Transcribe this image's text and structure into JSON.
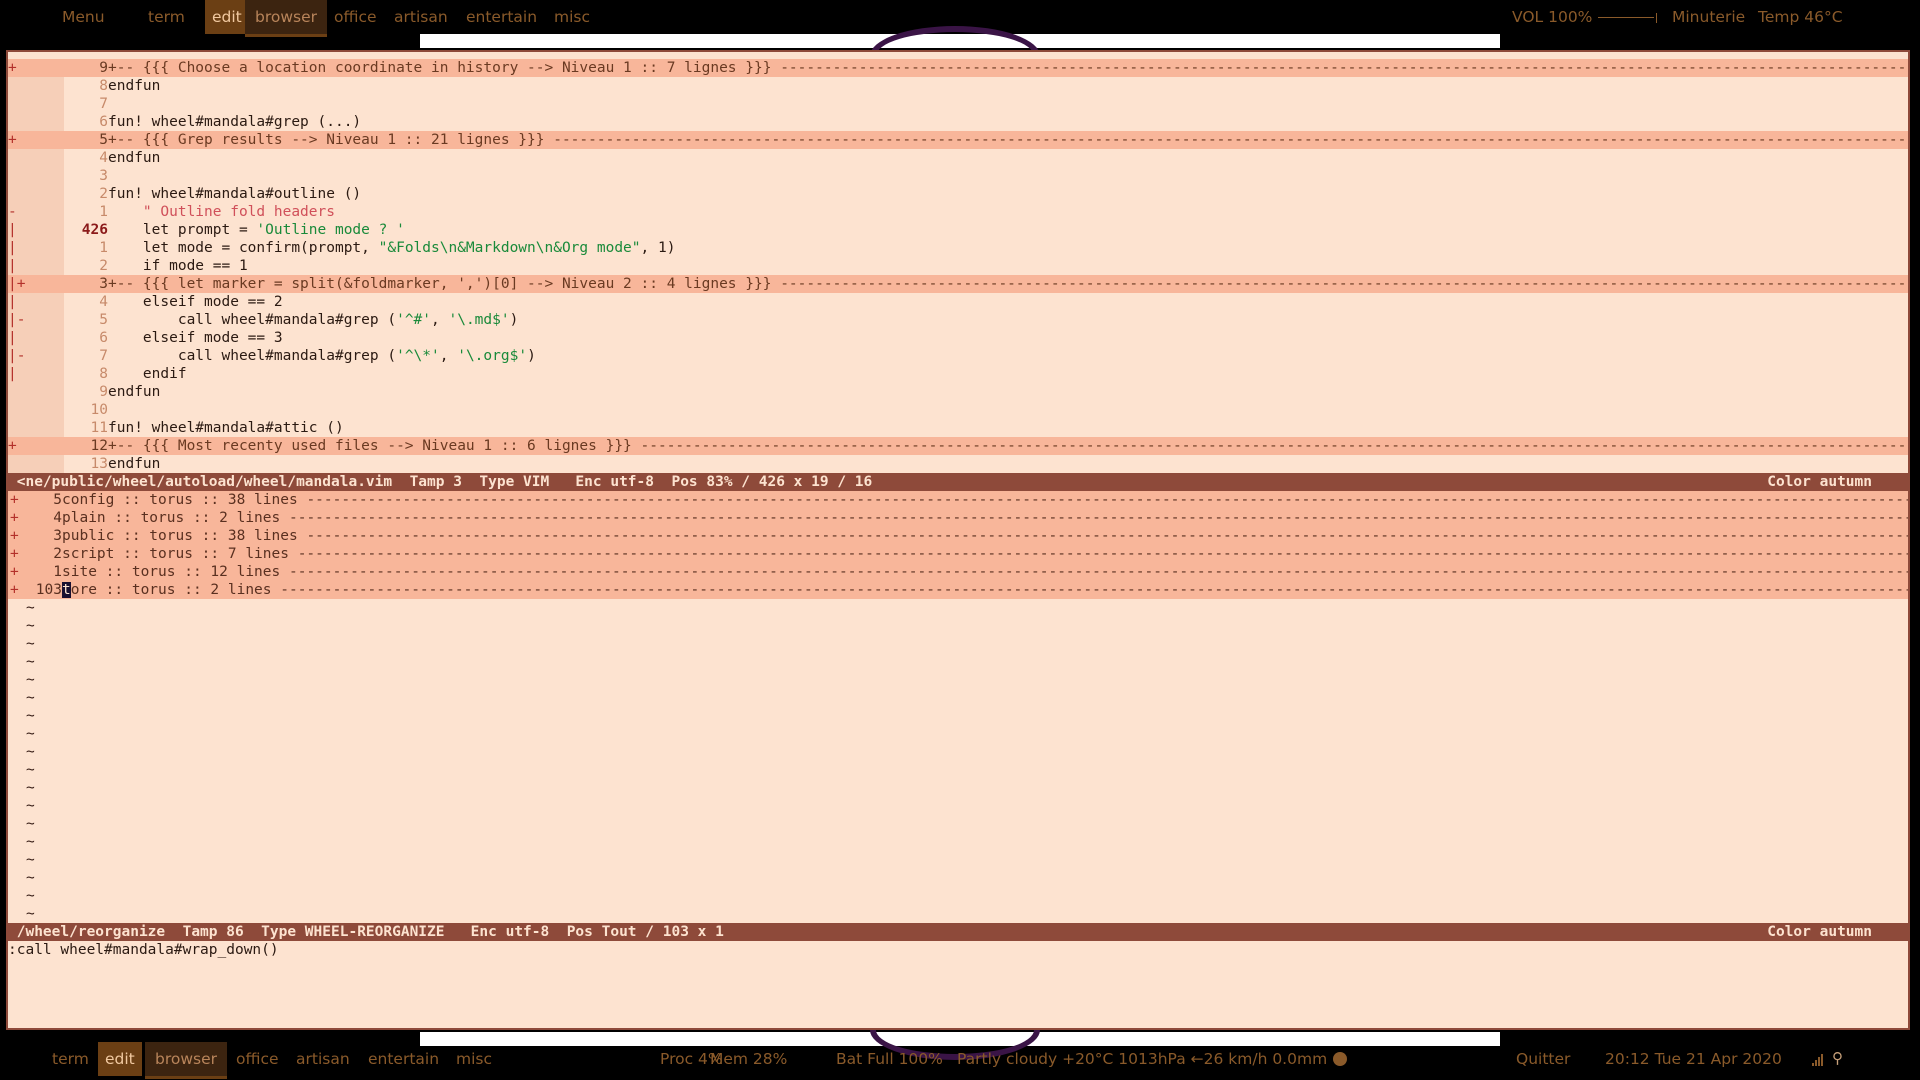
{
  "top_bar": {
    "menu": "Menu",
    "tags": [
      "term",
      "edit",
      "browser",
      "office",
      "artisan",
      "entertain",
      "misc"
    ],
    "volume": "VOL 100%",
    "timer": "Minuterie",
    "temp": "Temp  46°C"
  },
  "bottom_bar": {
    "tags": [
      "term",
      "edit",
      "browser",
      "office",
      "artisan",
      "entertain",
      "misc"
    ],
    "proc": "Proc  4%",
    "mem": "Mem 28%",
    "bat": "Bat Full 100%",
    "weather": "Partly cloudy +20°C 1013hPa ←26 km/h 0.0mm",
    "quit": "Quitter",
    "clock": "20:12  Tue 21 Apr 2020"
  },
  "editor_top": {
    "lines": [
      {
        "sign": "+",
        "num": "9",
        "text": "+-- {{{ Choose a location coordinate in history --> Niveau 1 :: 7 lignes }}} ",
        "fold": true
      },
      {
        "sign": "",
        "num": "8",
        "text": "endfun"
      },
      {
        "sign": "",
        "num": "7",
        "text": ""
      },
      {
        "sign": "",
        "num": "6",
        "text": "fun! wheel#mandala#grep (...)"
      },
      {
        "sign": "+",
        "num": "5",
        "text": "+-- {{{ Grep results --> Niveau 1 :: 21 lignes }}} ",
        "fold": true
      },
      {
        "sign": "",
        "num": "4",
        "text": "endfun"
      },
      {
        "sign": "",
        "num": "3",
        "text": ""
      },
      {
        "sign": "",
        "num": "2",
        "text": "fun! wheel#mandala#outline ()"
      },
      {
        "sign": "-",
        "num": "1",
        "text": "    \" Outline fold headers",
        "comment": true
      },
      {
        "sign": "|",
        "num": "426",
        "text": "    let prompt = 'Outline mode ? '",
        "cur": true
      },
      {
        "sign": "|",
        "num": "1",
        "text": "    let mode = confirm(prompt, \"&Folds\\n&Markdown\\n&Org mode\", 1)"
      },
      {
        "sign": "|",
        "num": "2",
        "text": "    if mode == 1"
      },
      {
        "sign": "|+",
        "num": "3",
        "text": "+-- {{{ let marker = split(&foldmarker, ',')[0] --> Niveau 2 :: 4 lignes }}} ",
        "fold": true
      },
      {
        "sign": "|",
        "num": "4",
        "text": "    elseif mode == 2"
      },
      {
        "sign": "|-",
        "num": "5",
        "text": "        call wheel#mandala#grep ('^#', '\\.md$')"
      },
      {
        "sign": "|",
        "num": "6",
        "text": "    elseif mode == 3"
      },
      {
        "sign": "|-",
        "num": "7",
        "text": "        call wheel#mandala#grep ('^\\*', '\\.org$')"
      },
      {
        "sign": "|",
        "num": "8",
        "text": "    endif"
      },
      {
        "sign": "",
        "num": "9",
        "text": "endfun"
      },
      {
        "sign": "",
        "num": "10",
        "text": ""
      },
      {
        "sign": "",
        "num": "11",
        "text": "fun! wheel#mandala#attic ()"
      },
      {
        "sign": "+",
        "num": "12",
        "text": "+-- {{{ Most recenty used files --> Niveau 1 :: 6 lignes }}} ",
        "fold": true
      },
      {
        "sign": "",
        "num": "13",
        "text": "endfun"
      }
    ],
    "status_left": " <ne/public/wheel/autoload/wheel/mandala.vim  Tamp 3  Type VIM   Enc utf-8  Pos 83% / 426 x 19 / 16",
    "status_right": "Color autumn"
  },
  "editor_bottom": {
    "lines": [
      {
        "sign": "+",
        "num": "5",
        "text": "config :: torus :: 38 lines "
      },
      {
        "sign": "+",
        "num": "4",
        "text": "plain :: torus :: 2 lines "
      },
      {
        "sign": "+",
        "num": "3",
        "text": "public :: torus :: 38 lines "
      },
      {
        "sign": "+",
        "num": "2",
        "text": "script :: torus :: 7 lines "
      },
      {
        "sign": "+",
        "num": "1",
        "text": "site :: torus :: 12 lines "
      },
      {
        "sign": "+",
        "num": "103",
        "cursor_char": "t",
        "text": "ore :: torus :: 2 lines "
      }
    ],
    "tilde": "~",
    "status_left": " /wheel/reorganize  Tamp 86  Type WHEEL-REORGANIZE   Enc utf-8  Pos Tout / 103 x 1",
    "status_right": "Color autumn"
  },
  "command_line": ":call wheel#mandala#wrap_down()"
}
